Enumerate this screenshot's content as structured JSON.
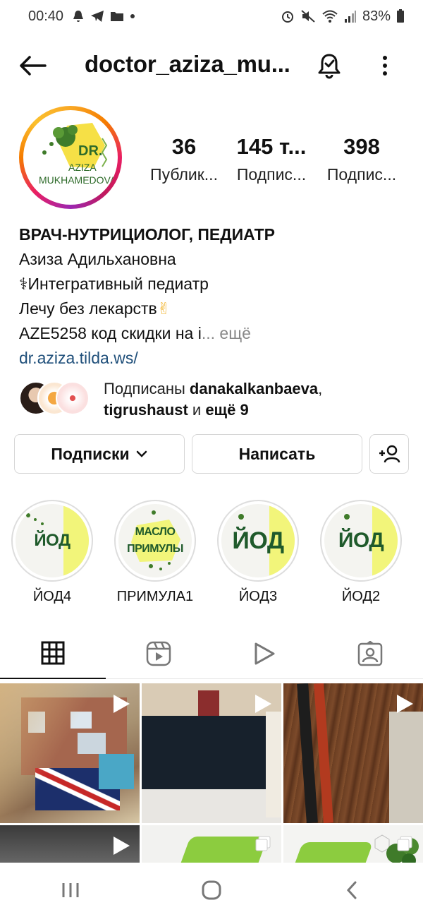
{
  "status": {
    "time": "00:40",
    "battery": "83%"
  },
  "header": {
    "username": "doctor_aziza_mu..."
  },
  "avatar": {
    "logo_top": "DR.",
    "logo_mid": "AZIZA",
    "logo_bottom": "MUKHAMEDOVA"
  },
  "stats": [
    {
      "number": "36",
      "label": "Публик..."
    },
    {
      "number": "145 т...",
      "label": "Подпис..."
    },
    {
      "number": "398",
      "label": "Подпис..."
    }
  ],
  "bio": {
    "title": "ВРАЧ-НУТРИЦИОЛОГ, ПЕДИАТР",
    "name": "Азиза Адильхановна",
    "line1": "Интегративный педиатр",
    "line2": "Лечу без лекарств",
    "line3": "AZE5258 код скидки на i",
    "more": "... ещё",
    "link": "dr.aziza.tilda.ws/"
  },
  "mutual": {
    "prefix": "Подписаны ",
    "user1": "danakalkanbaeva",
    "comma": ",",
    "user2": "tigrushaust",
    "and": " и ",
    "rest": "ещё 9"
  },
  "buttons": {
    "following": "Подписки",
    "message": "Написать"
  },
  "highlights": [
    {
      "label": "ЙОД4",
      "cover": "ЙОД"
    },
    {
      "label": "ПРИМУЛА1",
      "cover_l1": "МАСЛО",
      "cover_l2": "ПРИМУЛЫ"
    },
    {
      "label": "ЙОД3",
      "cover": "ЙОД"
    },
    {
      "label": "ЙОД2",
      "cover": "ЙОД"
    }
  ],
  "tabs": [
    "grid-icon",
    "reels-icon",
    "video-icon",
    "tagged-icon"
  ],
  "colors": {
    "link": "#1f4f7a",
    "highlight_green": "#1f5a2b",
    "highlight_yellow": "#f2f57a"
  }
}
